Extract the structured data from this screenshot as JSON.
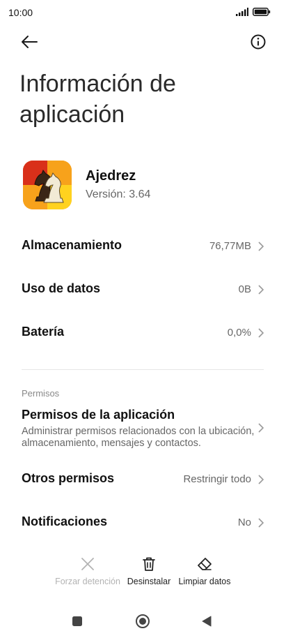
{
  "status_bar": {
    "time": "10:00"
  },
  "header": {
    "title_line1": "Información de",
    "title_line2": "aplicación"
  },
  "app": {
    "name": "Ajedrez",
    "version": "Versión: 3.64"
  },
  "rows": [
    {
      "label": "Almacenamiento",
      "value": "76,77MB"
    },
    {
      "label": "Uso de datos",
      "value": "0B"
    },
    {
      "label": "Batería",
      "value": "0,0%"
    }
  ],
  "permissions_section": {
    "header": "Permisos",
    "app_permissions": {
      "title": "Permisos de la aplicación",
      "description": "Administrar permisos relacionados con la ubicación, almacenamiento, mensajes y contactos."
    },
    "other_permissions": {
      "label": "Otros permisos",
      "value": "Restringir todo"
    },
    "notifications": {
      "label": "Notificaciones",
      "value": "No"
    }
  },
  "bottom_actions": {
    "force_stop": "Forzar detención",
    "uninstall": "Desinstalar",
    "clear_data": "Limpiar datos"
  },
  "colors": {
    "text_primary": "#111111",
    "text_secondary": "#666666",
    "disabled": "#b3b3b3",
    "icon_orange": "#f28c00",
    "icon_yellow": "#ffd21f",
    "icon_red": "#d9301a"
  }
}
